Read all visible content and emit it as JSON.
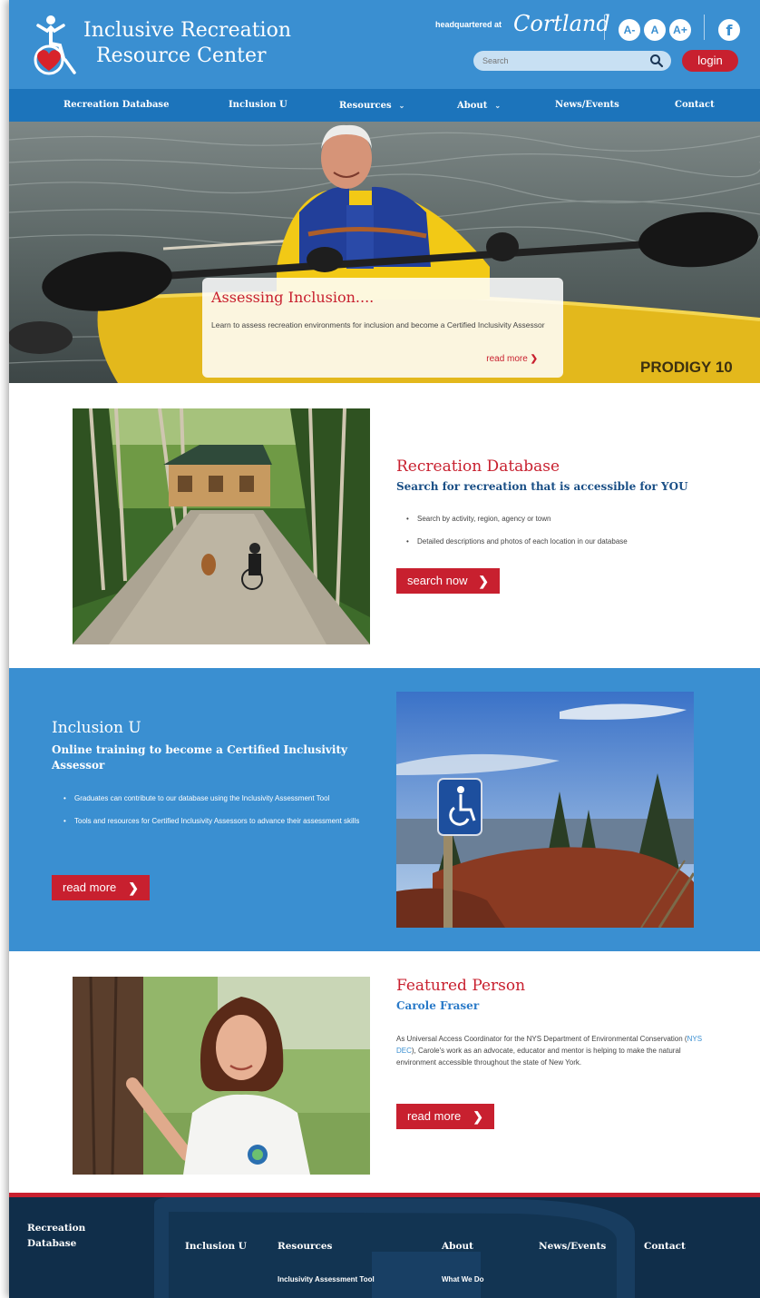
{
  "header": {
    "title_line1": "Inclusive Recreation",
    "title_line2": "Resource Center",
    "hq_label": "headquartered at",
    "hq_org": "Cortland",
    "font_buttons": [
      "A-",
      "A",
      "A+"
    ],
    "facebook_label": "f",
    "search_placeholder": "Search",
    "login_label": "login"
  },
  "nav": {
    "items": [
      {
        "label": "Recreation Database",
        "dropdown": false
      },
      {
        "label": "Inclusion U",
        "dropdown": false
      },
      {
        "label": "Resources",
        "dropdown": true
      },
      {
        "label": "About",
        "dropdown": true
      },
      {
        "label": "News/Events",
        "dropdown": false
      },
      {
        "label": "Contact",
        "dropdown": false
      }
    ]
  },
  "hero": {
    "title": "Assessing Inclusion....",
    "text": "Learn to assess recreation environments for inclusion and become a Certified Inclusivity Assessor",
    "read_more": "read more",
    "kayak_label": "PRODIGY 10"
  },
  "recreation_db": {
    "title": "Recreation Database",
    "subtitle": "Search for recreation that is accessible for YOU",
    "bullets": [
      "Search by activity, region, agency or town",
      "Detailed descriptions and photos of each location in our database"
    ],
    "button": "search now"
  },
  "inclusion_u": {
    "title": "Inclusion U",
    "subtitle": "Online training to become a Certified Inclusivity Assessor",
    "bullets": [
      "Graduates can contribute to our database using the Inclusivity Assessment Tool",
      "Tools and resources for Certified Inclusivity Assessors to advance their assessment skills"
    ],
    "button": "read more"
  },
  "featured": {
    "title": "Featured Person",
    "name": "Carole Fraser",
    "text_before": "As Universal Access Coordinator for the NYS Department of Environmental Conservation (",
    "link": "NYS DEC",
    "text_after": "), Carole's work as an advocate, educator and mentor is helping to make the natural environment accessible throughout the state of New York.",
    "button": "read more"
  },
  "footer": {
    "col1_line1": "Recreation",
    "col1_line2": "Database",
    "inclusion_u": "Inclusion U",
    "resources": "Resources",
    "resources_sub": "Inclusivity Assessment Tool",
    "about": "About",
    "about_sub": "What We Do",
    "news": "News/Events",
    "contact": "Contact"
  },
  "colors": {
    "header_blue": "#3a8fd1",
    "nav_blue": "#1c74bb",
    "accent_red": "#c8202f",
    "dark_navy": "#1a4f86",
    "footer_navy": "#102e4a"
  }
}
